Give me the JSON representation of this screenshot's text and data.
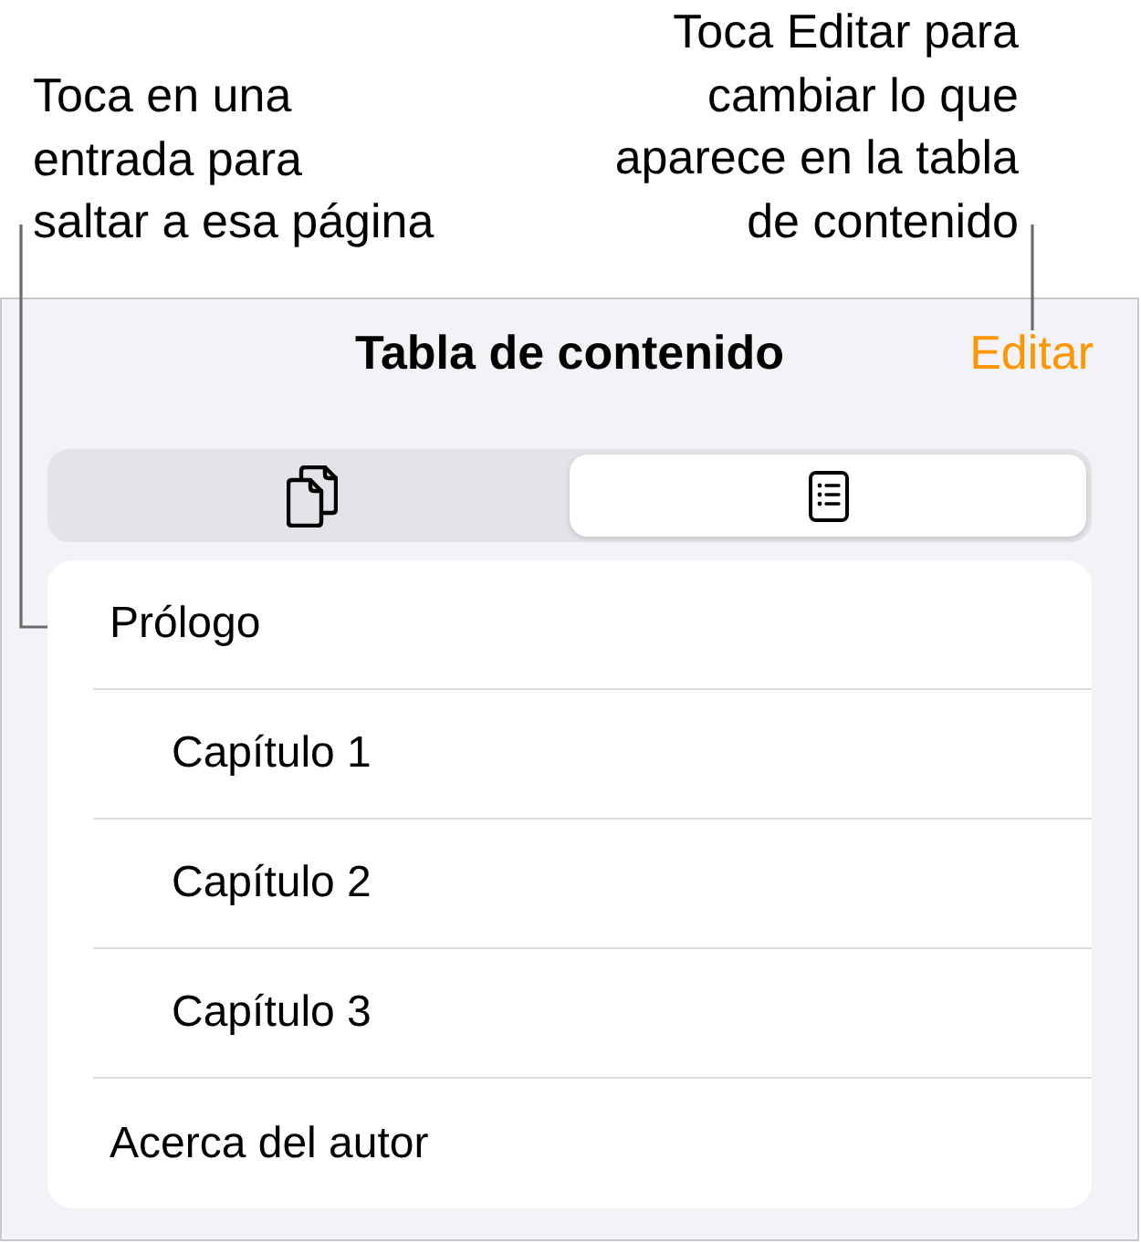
{
  "callouts": [
    {
      "lines": [
        "Toca en una",
        "entrada para",
        "saltar a esa página"
      ]
    },
    {
      "lines": [
        "Toca Editar para",
        "cambiar lo que",
        "aparece en la tabla",
        "de contenido"
      ]
    }
  ],
  "sheet": {
    "title": "Tabla de contenido",
    "action": "Editar"
  },
  "segments": [
    {
      "kind": "pages",
      "selected": false
    },
    {
      "kind": "contents",
      "selected": true
    }
  ],
  "contents": [
    {
      "label": "Prólogo",
      "children": [
        {
          "label": "Capítulo 1"
        },
        {
          "label": "Capítulo 2"
        },
        {
          "label": "Capítulo 3"
        }
      ]
    },
    {
      "label": "Acerca del autor"
    }
  ]
}
